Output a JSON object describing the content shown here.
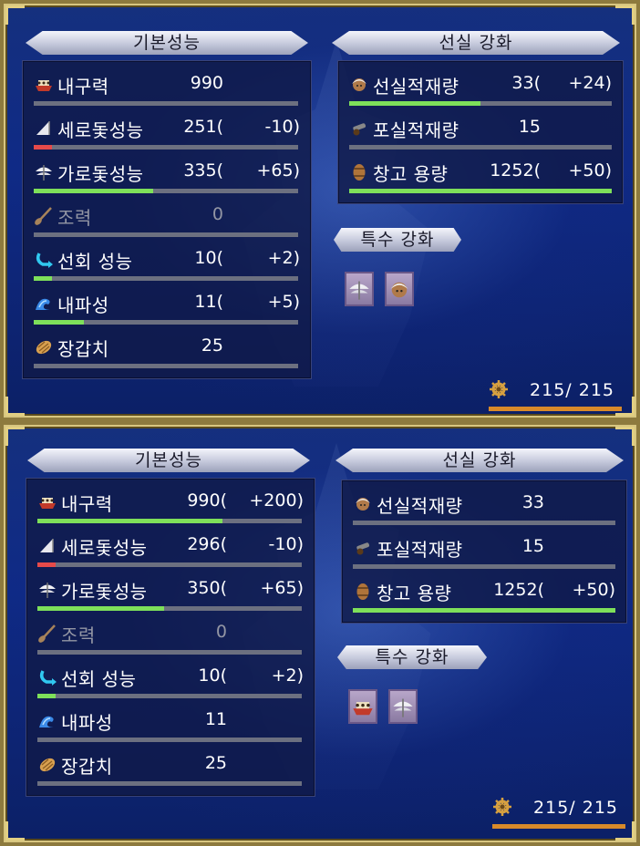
{
  "colors": {
    "green": "#7ee05a",
    "red": "#e64a4a",
    "empty": "#6c7080",
    "orange": "#d88a2a"
  },
  "panels": [
    {
      "basic_title": "기본성능",
      "enhance_title": "선실 강화",
      "special_title": "특수 강화",
      "basic_stats": [
        {
          "icon": "ship-icon",
          "label": "내구력",
          "value": "990",
          "delta": "",
          "fill": 0.0,
          "bar_color": "empty"
        },
        {
          "icon": "sail-icon",
          "label": "세로돛성능",
          "value": "251(",
          "delta": "-10)",
          "fill": 0.07,
          "bar_color": "red"
        },
        {
          "icon": "square-sail-icon",
          "label": "가로돛성능",
          "value": "335(",
          "delta": "+65)",
          "fill": 0.45,
          "bar_color": "green"
        },
        {
          "icon": "oar-icon",
          "label": "조력",
          "value": "0",
          "delta": "",
          "fill": 0.0,
          "bar_color": "empty",
          "disabled": true
        },
        {
          "icon": "turn-arrow-icon",
          "label": "선회 성능",
          "value": "10(",
          "delta": "+2)",
          "fill": 0.07,
          "bar_color": "green"
        },
        {
          "icon": "wave-icon",
          "label": "내파성",
          "value": "11(",
          "delta": "+5)",
          "fill": 0.19,
          "bar_color": "green"
        },
        {
          "icon": "armor-icon",
          "label": "장갑치",
          "value": "25",
          "delta": "",
          "fill": 0.0,
          "bar_color": "empty"
        }
      ],
      "enhance_stats": [
        {
          "icon": "sailor-icon",
          "label": "선실적재량",
          "value": "33(",
          "delta": "+24)",
          "fill": 0.5,
          "bar_color": "green"
        },
        {
          "icon": "cannon-icon",
          "label": "포실적재량",
          "value": "15",
          "delta": "",
          "fill": 0.0,
          "bar_color": "empty"
        },
        {
          "icon": "barrel-icon",
          "label": "창고 용량",
          "value": "1252(",
          "delta": "+50)",
          "fill": 1.0,
          "bar_color": "green"
        }
      ],
      "special_icons": [
        "square-sail-icon",
        "sailor-icon"
      ],
      "capacity": "215/ 215"
    },
    {
      "basic_title": "기본성능",
      "enhance_title": "선실 강화",
      "special_title": "특수 강화",
      "basic_stats": [
        {
          "icon": "ship-icon",
          "label": "내구력",
          "value": "990(",
          "delta": "+200)",
          "fill": 0.7,
          "bar_color": "green"
        },
        {
          "icon": "sail-icon",
          "label": "세로돛성능",
          "value": "296(",
          "delta": "-10)",
          "fill": 0.07,
          "bar_color": "red"
        },
        {
          "icon": "square-sail-icon",
          "label": "가로돛성능",
          "value": "350(",
          "delta": "+65)",
          "fill": 0.48,
          "bar_color": "green"
        },
        {
          "icon": "oar-icon",
          "label": "조력",
          "value": "0",
          "delta": "",
          "fill": 0.0,
          "bar_color": "empty",
          "disabled": true
        },
        {
          "icon": "turn-arrow-icon",
          "label": "선회 성능",
          "value": "10(",
          "delta": "+2)",
          "fill": 0.07,
          "bar_color": "green"
        },
        {
          "icon": "wave-icon",
          "label": "내파성",
          "value": "11",
          "delta": "",
          "fill": 0.0,
          "bar_color": "empty"
        },
        {
          "icon": "armor-icon",
          "label": "장갑치",
          "value": "25",
          "delta": "",
          "fill": 0.0,
          "bar_color": "empty"
        }
      ],
      "enhance_stats": [
        {
          "icon": "sailor-icon",
          "label": "선실적재량",
          "value": "33",
          "delta": "",
          "fill": 0.0,
          "bar_color": "empty"
        },
        {
          "icon": "cannon-icon",
          "label": "포실적재량",
          "value": "15",
          "delta": "",
          "fill": 0.0,
          "bar_color": "empty"
        },
        {
          "icon": "barrel-icon",
          "label": "창고 용량",
          "value": "1252(",
          "delta": "+50)",
          "fill": 1.0,
          "bar_color": "green"
        }
      ],
      "special_icons": [
        "ship-icon",
        "square-sail-icon"
      ],
      "capacity": "215/ 215"
    }
  ]
}
